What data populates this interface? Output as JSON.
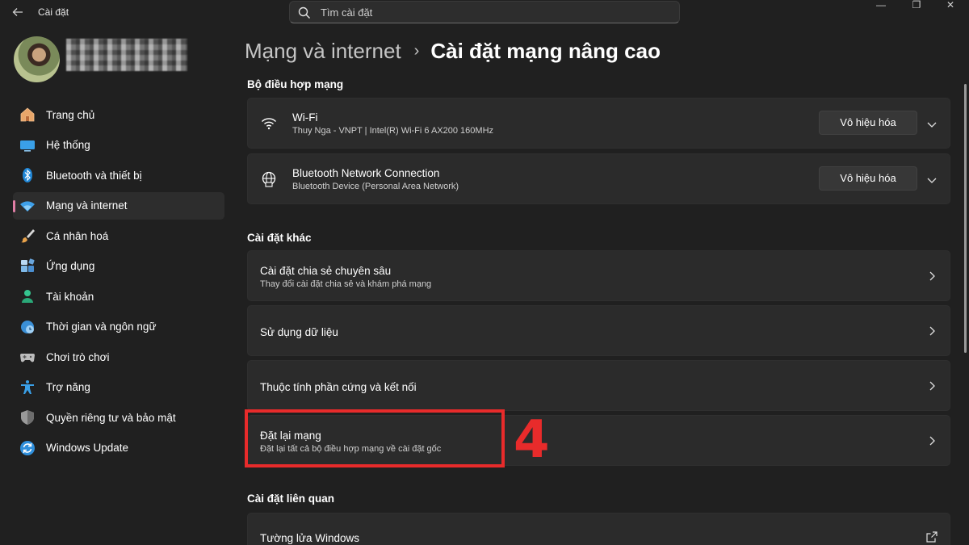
{
  "app": {
    "title": "Cài đặt",
    "search_placeholder": "Tìm cài đặt",
    "window_controls": {
      "minimize": "—",
      "maximize": "❐",
      "close": "✕"
    }
  },
  "sidebar": {
    "items": [
      {
        "label": "Trang chủ",
        "icon": "home-icon",
        "active": false
      },
      {
        "label": "Hệ thống",
        "icon": "system-icon",
        "active": false
      },
      {
        "label": "Bluetooth và thiết bị",
        "icon": "bluetooth-icon",
        "active": false
      },
      {
        "label": "Mạng và internet",
        "icon": "wifi-icon",
        "active": true
      },
      {
        "label": "Cá nhân hoá",
        "icon": "brush-icon",
        "active": false
      },
      {
        "label": "Ứng dụng",
        "icon": "apps-icon",
        "active": false
      },
      {
        "label": "Tài khoản",
        "icon": "account-icon",
        "active": false
      },
      {
        "label": "Thời gian và ngôn ngữ",
        "icon": "time-language-icon",
        "active": false
      },
      {
        "label": "Chơi trò chơi",
        "icon": "gaming-icon",
        "active": false
      },
      {
        "label": "Trợ năng",
        "icon": "accessibility-icon",
        "active": false
      },
      {
        "label": "Quyền riêng tư và bảo mật",
        "icon": "shield-icon",
        "active": false
      },
      {
        "label": "Windows Update",
        "icon": "update-icon",
        "active": false
      }
    ]
  },
  "breadcrumb": {
    "parent": "Mạng và internet",
    "separator": "›",
    "current": "Cài đặt mạng nâng cao"
  },
  "sections": {
    "adapters": {
      "title": "Bộ điều hợp mạng",
      "items": [
        {
          "title": "Wi-Fi",
          "subtitle": "Thuy Nga - VNPT | Intel(R) Wi-Fi 6 AX200 160MHz",
          "button": "Vô hiệu hóa",
          "icon": "wifi-icon"
        },
        {
          "title": "Bluetooth Network Connection",
          "subtitle": "Bluetooth Device (Personal Area Network)",
          "button": "Vô hiệu hóa",
          "icon": "ethernet-globe-icon"
        }
      ]
    },
    "other": {
      "title": "Cài đặt khác",
      "items": [
        {
          "title": "Cài đặt chia sẻ chuyên sâu",
          "subtitle": "Thay đổi cài đặt chia sẻ và khám phá mạng"
        },
        {
          "title": "Sử dụng dữ liệu",
          "subtitle": ""
        },
        {
          "title": "Thuộc tính phần cứng và kết nối",
          "subtitle": ""
        },
        {
          "title": "Đặt lại mạng",
          "subtitle": "Đặt lại tất cả bộ điều hợp mạng về cài đặt gốc"
        }
      ]
    },
    "related": {
      "title": "Cài đặt liên quan",
      "items": [
        {
          "title": "Tường lửa Windows"
        }
      ]
    }
  },
  "annotation": {
    "step": "4",
    "color": "#e82b2b"
  },
  "colors": {
    "background": "#202020",
    "card": "#2b2b2b",
    "accent_indicator": "#e07ea5"
  }
}
